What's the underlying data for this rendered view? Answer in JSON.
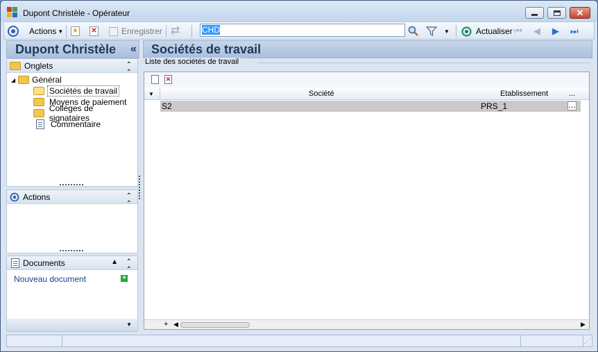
{
  "window": {
    "title": "Dupont Christèle -  Opérateur",
    "controls": {
      "minimize": "minimize-icon",
      "maximize": "maximize-icon",
      "close": "close-icon"
    }
  },
  "toolbar": {
    "actions_label": "Actions",
    "save_label": "Enregistrer",
    "search_value": "CHD",
    "refresh_label": "Actualiser"
  },
  "left": {
    "header_title": "Dupont Christèle",
    "collapse_glyph": "«",
    "onglets": {
      "title": "Onglets",
      "tree": {
        "root": "Général",
        "children": [
          "Sociétés de travail",
          "Moyens de paiement",
          "Collèges de signataires",
          "Commentaire"
        ]
      }
    },
    "actions": {
      "title": "Actions"
    },
    "documents": {
      "title": "Documents",
      "new_doc": "Nouveau document"
    }
  },
  "main": {
    "title": "Sociétés de travail",
    "group_label": "Liste des sociétés de travail",
    "columns": [
      "Société",
      "Etablissement",
      "..."
    ],
    "rows": [
      {
        "societe": "S2",
        "etablissement": "PRS_1",
        "more": "..."
      }
    ]
  },
  "colors": {
    "accent": "#1e395b",
    "window_bg": "#dbe5f1",
    "selected_row": "#c9c9c9",
    "search_highlight": "#3399ff"
  }
}
